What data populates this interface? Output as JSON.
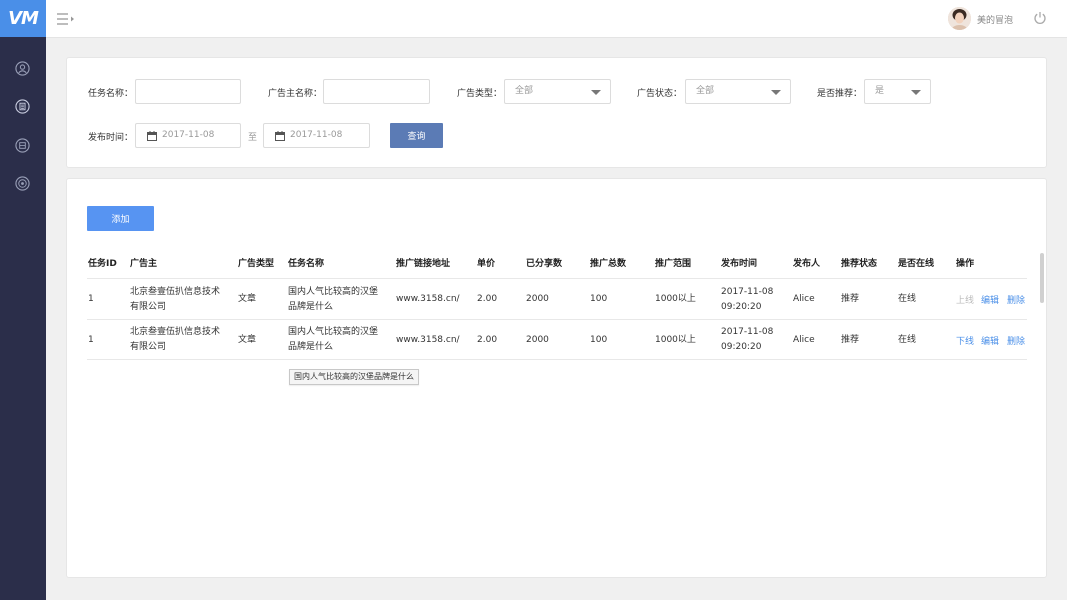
{
  "app": {
    "logo": "VM",
    "accent": "#4a8fe8",
    "sidebar_bg": "#2b2e4a"
  },
  "sidebar": {
    "items": [
      {
        "icon": "user-icon"
      },
      {
        "icon": "document-icon"
      },
      {
        "icon": "media-icon"
      },
      {
        "icon": "target-icon"
      }
    ]
  },
  "header": {
    "username": "美的冒泡",
    "menu_icon": "menu-toggle-icon",
    "power_icon": "power-icon"
  },
  "filters": {
    "task_name_label": "任务名称：",
    "task_name_value": "",
    "advertiser_label": "广告主名称：",
    "advertiser_value": "",
    "ad_type_label": "广告类型：",
    "ad_type_value": "全部",
    "ad_status_label": "广告状态：",
    "ad_status_value": "全部",
    "recommend_label": "是否推荐：",
    "recommend_value": "是",
    "publish_time_label": "发布时间：",
    "date_from": "2017-11-08",
    "to_label": "至",
    "date_to": "2017-11-08",
    "query_button": "查询"
  },
  "table": {
    "add_button": "添加",
    "headers": [
      "任务ID",
      "广告主",
      "广告类型",
      "任务名称",
      "推广链接地址",
      "单价",
      "已分享数",
      "推广总数",
      "推广范围",
      "发布时间",
      "发布人",
      "推荐状态",
      "是否在线",
      "操作"
    ],
    "rows": [
      {
        "id": "1",
        "advertiser_l1": "北京叁壹伍扒信息技术",
        "advertiser_l2": "有限公司",
        "ad_type": "文章",
        "task_l1": "国内人气比较高的汉堡",
        "task_l2": "品牌是什么",
        "url": "www.3158.cn/",
        "price": "2.00",
        "shared": "2000",
        "total": "100",
        "range": "1000以上",
        "date": "2017-11-08",
        "time": "09:20:20",
        "publisher": "Alice",
        "recommend": "推荐",
        "online": "在线",
        "op_toggle": "上线",
        "op_edit": "编辑",
        "op_delete": "删除"
      },
      {
        "id": "1",
        "advertiser_l1": "北京叁壹伍扒信息技术",
        "advertiser_l2": "有限公司",
        "ad_type": "文章",
        "task_l1": "国内人气比较高的汉堡",
        "task_l2": "品牌是什么",
        "url": "www.3158.cn/",
        "price": "2.00",
        "shared": "2000",
        "total": "100",
        "range": "1000以上",
        "date": "2017-11-08",
        "time": "09:20:20",
        "publisher": "Alice",
        "recommend": "推荐",
        "online": "在线",
        "op_toggle": "下线",
        "op_edit": "编辑",
        "op_delete": "删除"
      }
    ],
    "tooltip": "国内人气比较高的汉堡品牌是什么"
  }
}
